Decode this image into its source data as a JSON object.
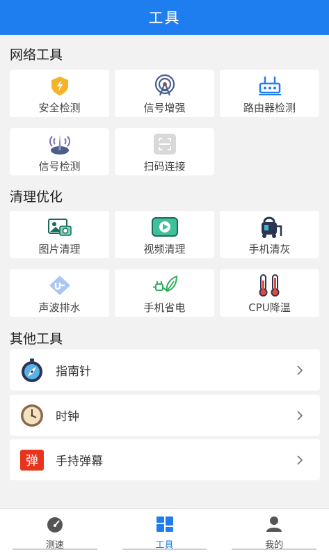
{
  "header": {
    "title": "工具"
  },
  "sections": {
    "network": {
      "title": "网络工具",
      "items": [
        {
          "label": "安全检测",
          "icon": "shield-icon"
        },
        {
          "label": "信号增强",
          "icon": "antenna-icon"
        },
        {
          "label": "路由器检测",
          "icon": "router-icon"
        },
        {
          "label": "信号检测",
          "icon": "signal-tower-icon"
        },
        {
          "label": "扫码连接",
          "icon": "scan-icon"
        }
      ]
    },
    "clean": {
      "title": "清理优化",
      "items": [
        {
          "label": "图片清理",
          "icon": "image-icon"
        },
        {
          "label": "视频清理",
          "icon": "video-icon"
        },
        {
          "label": "手机清灰",
          "icon": "vacuum-icon"
        },
        {
          "label": "声波排水",
          "icon": "water-drain-icon"
        },
        {
          "label": "手机省电",
          "icon": "power-save-icon"
        },
        {
          "label": "CPU降温",
          "icon": "thermometer-icon"
        }
      ]
    },
    "other": {
      "title": "其他工具",
      "items": [
        {
          "label": "指南针",
          "icon": "compass-icon"
        },
        {
          "label": "时钟",
          "icon": "clock-icon"
        },
        {
          "label": "手持弹幕",
          "icon": "bullet-comment-icon",
          "badge": "弹"
        }
      ]
    }
  },
  "tabbar": {
    "items": [
      {
        "label": "测速",
        "icon": "speedometer-icon"
      },
      {
        "label": "工具",
        "icon": "tools-grid-icon",
        "active": true
      },
      {
        "label": "我的",
        "icon": "user-icon"
      }
    ]
  },
  "colors": {
    "primary": "#1e7ef0",
    "background": "#f2f2f2"
  }
}
